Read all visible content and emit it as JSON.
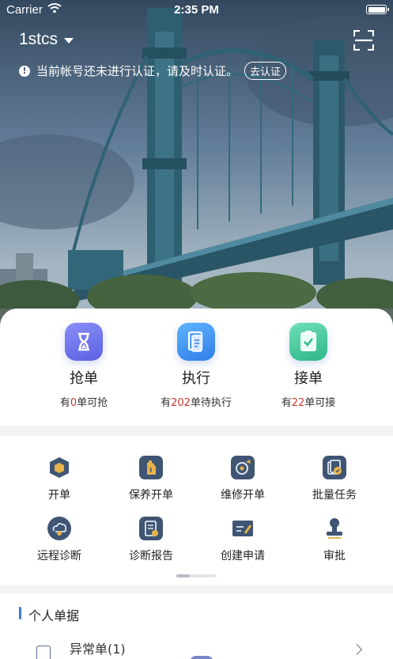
{
  "status_bar": {
    "carrier": "Carrier",
    "time": "2:35 PM"
  },
  "header": {
    "account": "1stcs",
    "notice": "当前帐号还未进行认证，请及时认证。",
    "verify_button": "去认证"
  },
  "quick_actions": [
    {
      "title": "抢单",
      "prefix": "有",
      "count": "0",
      "suffix": "单可抢",
      "icon": "hourglass-icon",
      "color": "#6a6ff0"
    },
    {
      "title": "执行",
      "prefix": "有",
      "count": "202",
      "suffix": "单待执行",
      "icon": "clipboard-icon",
      "color": "#3f8ef0"
    },
    {
      "title": "接单",
      "prefix": "有",
      "count": "22",
      "suffix": "单可接",
      "icon": "clipboard-check-icon",
      "color": "#3cc49a"
    }
  ],
  "grid": [
    {
      "label": "开单",
      "icon": "hexagon-icon"
    },
    {
      "label": "保养开单",
      "icon": "oil-bottle-icon"
    },
    {
      "label": "维修开单",
      "icon": "repair-icon"
    },
    {
      "label": "批量任务",
      "icon": "batch-tasks-icon"
    },
    {
      "label": "远程诊断",
      "icon": "cloud-diagnose-icon"
    },
    {
      "label": "诊断报告",
      "icon": "report-icon"
    },
    {
      "label": "创建申请",
      "icon": "edit-card-icon"
    },
    {
      "label": "审批",
      "icon": "stamp-icon"
    }
  ],
  "docs": {
    "title": "个人单据",
    "rows": [
      {
        "label": "异常单(1)"
      }
    ]
  },
  "colors": {
    "accent": "#3f77d6",
    "count_red": "#c8372d"
  }
}
